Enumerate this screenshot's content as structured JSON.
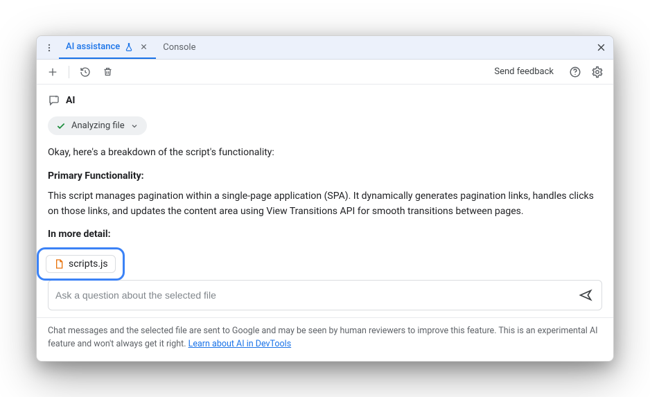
{
  "tabs": {
    "kebab_icon": "more-vert",
    "active": {
      "label": "AI assistance"
    },
    "secondary": {
      "label": "Console"
    }
  },
  "toolbar": {
    "feedback": "Send feedback"
  },
  "ai": {
    "title": "AI"
  },
  "status": {
    "label": "Analyzing file"
  },
  "response": {
    "intro": "Okay, here's a breakdown of the script's functionality:",
    "heading1": "Primary Functionality:",
    "para1": "This script manages pagination within a single-page application (SPA). It dynamically generates pagination links, handles clicks on those links, and updates the content area using View Transitions API for smooth transitions between pages.",
    "heading2": "In more detail:"
  },
  "selected_file": {
    "name": "scripts.js"
  },
  "input": {
    "placeholder": "Ask a question about the selected file"
  },
  "disclaimer": {
    "text_before": "Chat messages and the selected file are sent to Google and may be seen by human reviewers to improve this feature. This is an experimental AI feature and won't always get it right. ",
    "link": "Learn about AI in DevTools"
  }
}
